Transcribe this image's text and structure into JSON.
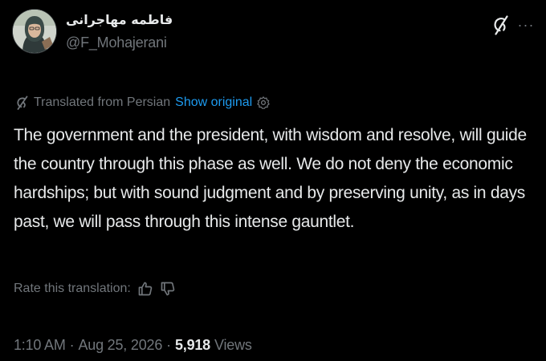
{
  "author": {
    "display_name": "فاطمه مهاجرانی",
    "handle": "@F_Mohajerani",
    "avatar": "avatar-photo"
  },
  "header_icons": {
    "grok": "grok-icon",
    "more": "more-icon",
    "more_glyph": "···"
  },
  "translation": {
    "label": "Translated from Persian",
    "show_original": "Show original",
    "rate_label": "Rate this translation:"
  },
  "tweet": {
    "text": "The government and the president, with wisdom and resolve, will guide the country through this phase as well. We do not deny the economic hardships; but with sound judgment and by preserving unity, as in days past, we will pass through this intense gauntlet."
  },
  "meta": {
    "time": "1:10 AM",
    "date": "Aug 25, 2026",
    "separator": "·",
    "views_count": "5,918",
    "views_label": "Views"
  },
  "colors": {
    "background": "#000000",
    "text": "#e7e9ea",
    "muted": "#71767b",
    "link": "#1d9bf0"
  }
}
